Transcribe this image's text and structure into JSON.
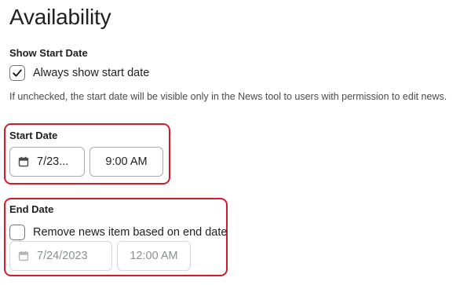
{
  "page": {
    "title": "Availability"
  },
  "show_start_date": {
    "label": "Show Start Date",
    "checkbox_label": "Always show start date",
    "checked": true,
    "help_text": "If unchecked, the start date will be visible only in the News tool to users with permission to edit news."
  },
  "start_date": {
    "label": "Start Date",
    "date_value": "7/23...",
    "time_value": "9:00 AM",
    "date_icon": "calendar-icon"
  },
  "end_date": {
    "label": "End Date",
    "checkbox_label": "Remove news item based on end date",
    "checked": false,
    "date_value": "7/24/2023",
    "time_value": "12:00 AM",
    "date_icon": "calendar-icon",
    "disabled": true
  },
  "colors": {
    "highlight": "#d01c2b",
    "text": "#202122",
    "muted_text": "#494c4e",
    "disabled_text": "#8a8f93",
    "field_border": "#a8adb1"
  }
}
